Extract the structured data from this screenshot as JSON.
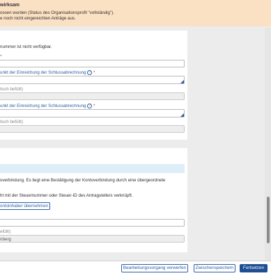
{
  "banner": {
    "title": "wirksam",
    "line1": "ossen wurden (Status des Organisationsprofil \"vollständig\").",
    "line2": "e noch nicht eingereichten Anträge aus."
  },
  "section1": {
    "note": "nummer ist nicht verfügbar.",
    "field1_label": "*",
    "field1_value": "",
    "field2_label": "unkt der Einreichung der Schlussabrechnung",
    "field2_req": "*",
    "field2_hint": "tisch befüllt)",
    "field3_label": "unkt der Einreichung der Schlussabrechnung",
    "field3_req": "*",
    "field3_hint": "tisch befüllt)",
    "help_glyph": "?"
  },
  "section2": {
    "info_line": "overbindung. Es liegt eine Bestätigung der Kontoverbindung durch eine übergeordnete",
    "link_note": "ht mit der Steuernummer oder Steuer-ID des Antragstellers verknüpft.",
    "adopt_button": "ontoinhaber übernehmen",
    "field_value": "",
    "ro_hint": "efüllt)",
    "ro_value": "nberg"
  },
  "footer": {
    "discard": "Bearbeitungsvorgang verwerfen",
    "save": "Zwischenspeichern",
    "continue": "Fortsetzen"
  }
}
